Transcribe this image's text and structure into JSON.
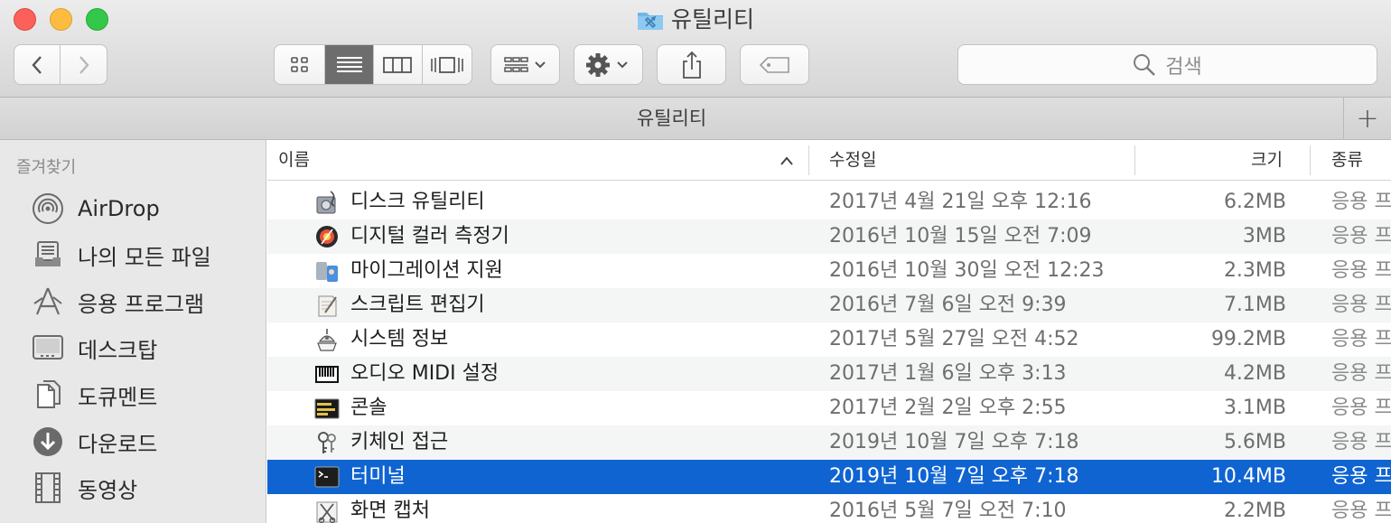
{
  "window": {
    "title": "유틸리티",
    "folder_icon": "utilities-folder-icon"
  },
  "toolbar": {
    "back_icon": "chevron-left-icon",
    "forward_icon": "chevron-right-icon",
    "view_modes": [
      "icon-view",
      "list-view",
      "column-view",
      "cover-flow-view"
    ],
    "active_view": "list-view",
    "search_placeholder": "검색"
  },
  "pathbar": {
    "label": "유틸리티",
    "plus": "+"
  },
  "sidebar": {
    "section_title": "즐겨찾기",
    "items": [
      {
        "label": "AirDrop",
        "icon": "airdrop-icon"
      },
      {
        "label": "나의 모든 파일",
        "icon": "all-files-icon"
      },
      {
        "label": "응용 프로그램",
        "icon": "applications-icon"
      },
      {
        "label": "데스크탑",
        "icon": "desktop-icon"
      },
      {
        "label": "도큐멘트",
        "icon": "documents-icon"
      },
      {
        "label": "다운로드",
        "icon": "downloads-icon"
      },
      {
        "label": "동영상",
        "icon": "movies-icon"
      }
    ]
  },
  "columns": {
    "name": "이름",
    "date": "수정일",
    "size": "크기",
    "kind": "종류"
  },
  "files": [
    {
      "name": "디스크 유틸리티",
      "date": "2017년 4월 21일 오후 12:16",
      "size": "6.2MB",
      "kind": "응용 프",
      "icon": "disk-utility-icon"
    },
    {
      "name": "디지털 컬러 측정기",
      "date": "2016년 10월 15일 오전 7:09",
      "size": "3MB",
      "kind": "응용 프",
      "icon": "color-meter-icon"
    },
    {
      "name": "마이그레이션 지원",
      "date": "2016년 10월 30일 오전 12:23",
      "size": "2.3MB",
      "kind": "응용 프",
      "icon": "migration-assistant-icon"
    },
    {
      "name": "스크립트 편집기",
      "date": "2016년 7월 6일 오전 9:39",
      "size": "7.1MB",
      "kind": "응용 프",
      "icon": "script-editor-icon"
    },
    {
      "name": "시스템 정보",
      "date": "2017년 5월 27일 오전 4:52",
      "size": "99.2MB",
      "kind": "응용 프",
      "icon": "system-information-icon"
    },
    {
      "name": "오디오 MIDI 설정",
      "date": "2017년 1월 6일 오후 3:13",
      "size": "4.2MB",
      "kind": "응용 프",
      "icon": "audio-midi-icon"
    },
    {
      "name": "콘솔",
      "date": "2017년 2월 2일 오후 2:55",
      "size": "3.1MB",
      "kind": "응용 프",
      "icon": "console-icon"
    },
    {
      "name": "키체인 접근",
      "date": "2019년 10월 7일 오후 7:18",
      "size": "5.6MB",
      "kind": "응용 프",
      "icon": "keychain-icon"
    },
    {
      "name": "터미널",
      "date": "2019년 10월 7일 오후 7:18",
      "size": "10.4MB",
      "kind": "응용 프",
      "icon": "terminal-icon"
    },
    {
      "name": "화면 캡처",
      "date": "2016년 5월 7일 오전 7:10",
      "size": "2.2MB",
      "kind": "응용 프",
      "icon": "screenshot-icon"
    }
  ],
  "selected_index": 8
}
